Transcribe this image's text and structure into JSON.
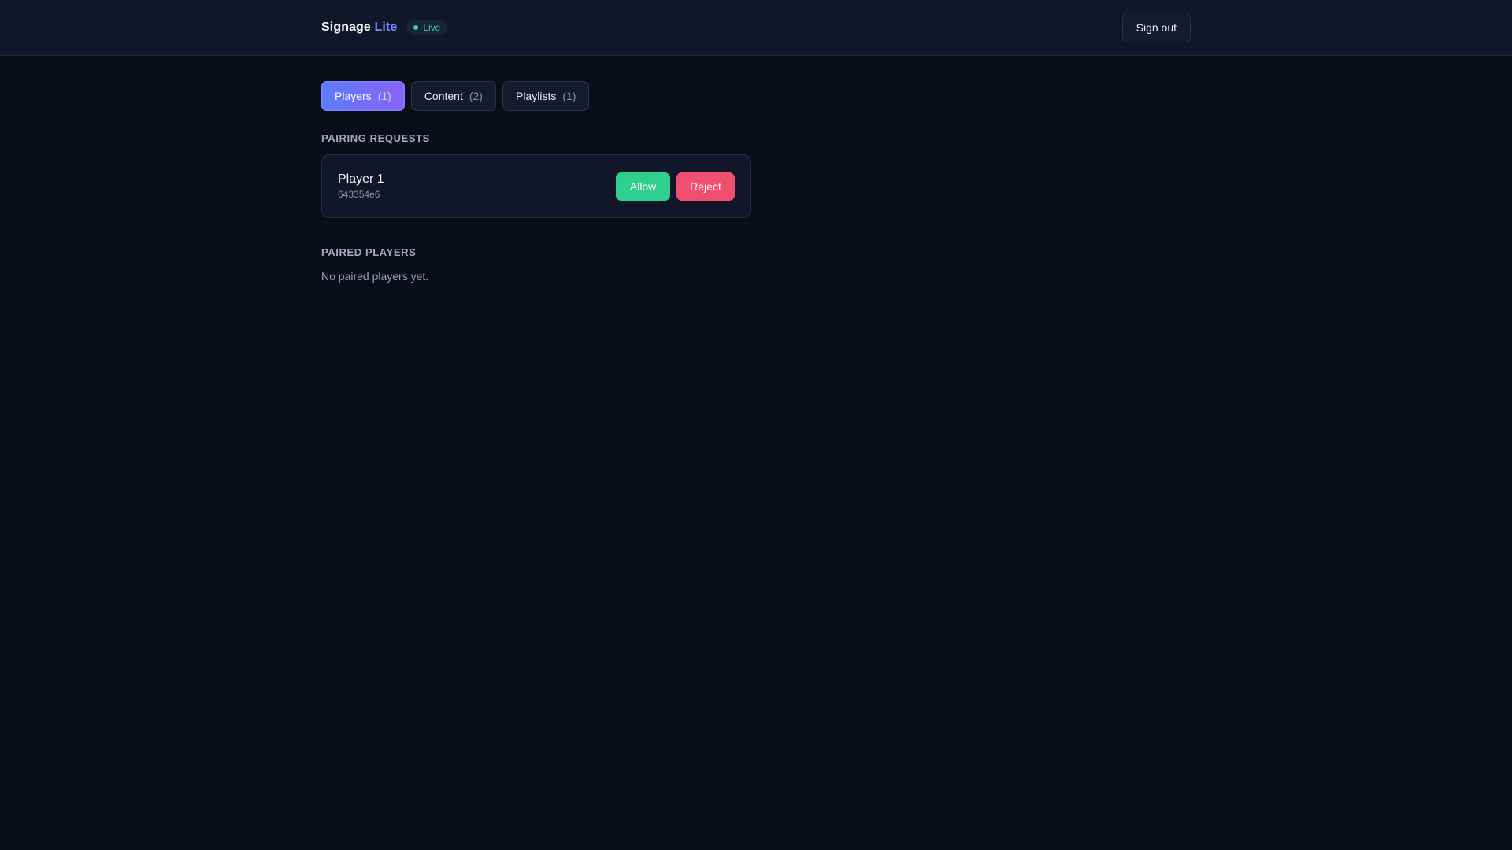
{
  "header": {
    "brand_name": "Signage",
    "brand_accent": "Lite",
    "status_label": "Live",
    "signout_label": "Sign out"
  },
  "tabs": [
    {
      "label": "Players",
      "count": "(1)",
      "active": true
    },
    {
      "label": "Content",
      "count": "(2)",
      "active": false
    },
    {
      "label": "Playlists",
      "count": "(1)",
      "active": false
    }
  ],
  "pairing": {
    "title": "PAIRING REQUESTS",
    "requests": [
      {
        "name": "Player 1",
        "id": "643354e6",
        "allow_label": "Allow",
        "reject_label": "Reject"
      }
    ]
  },
  "paired": {
    "title": "PAIRED PLAYERS",
    "empty_message": "No paired players yet."
  },
  "colors": {
    "accent": "#6f8cff",
    "live": "#34d399",
    "allow": "#2fd08f",
    "reject": "#f0506e",
    "background": "#0a0d17"
  }
}
